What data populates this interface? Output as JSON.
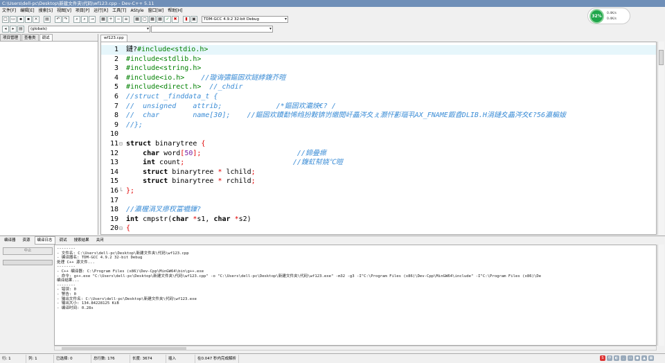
{
  "window": {
    "title": "C:\\Users\\dell-pc\\Desktop\\新建文件夹\\代码\\wf123.cpp - Dev-C++ 5.11"
  },
  "menu": [
    "文件[F]",
    "编辑[E]",
    "搜索[S]",
    "视图[V]",
    "项目[P]",
    "运行[R]",
    "工具[T]",
    "AStyle",
    "窗口[W]",
    "帮助[H]"
  ],
  "toolbar": {
    "compiler": "TDM-GCC 4.9.2 32-bit Debug",
    "scope": "(globals)"
  },
  "widget": {
    "percent": "32%",
    "up": "0.4K/s",
    "down": "0.4K/s"
  },
  "left_tabs": [
    "项目管理",
    "查看类",
    "调试"
  ],
  "editor": {
    "tab": "wf123.cpp",
    "lines": [
      {
        "n": "1",
        "t": "#include<stdio.h>",
        "k": "pp",
        "cur": true,
        "g": "鏈?"
      },
      {
        "n": "2",
        "t": "#include<stdlib.h>",
        "k": "pp"
      },
      {
        "n": "3",
        "t": "#include<string.h>",
        "k": "pp"
      },
      {
        "n": "4",
        "t": "#include<io.h>",
        "k": "pp",
        "c": "    //璇诲彇鏂囦欢鐩綍鍑芥暟"
      },
      {
        "n": "5",
        "t": "#include<direct.h>",
        "k": "pp",
        "c": "  //_chdir"
      },
      {
        "n": "6",
        "t": "//struct _finddata_t {",
        "k": "cm"
      },
      {
        "n": "7",
        "t": "//  unsigned    attrib;             /*鏂囦欢灞炴€? /",
        "k": "cm"
      },
      {
        "n": "8",
        "t": "//  char        name[30];    //鏂囦欢鐨勫悕绉扮敤锛岃繖閲屽畾涔夊ぇ灏忓彲瑙丮AX_FNAME鍜孴DLIB.H涓鏈夊畾涔夊€?56瀛楄妭",
        "k": "cm"
      },
      {
        "n": "9",
        "t": "//};",
        "k": "cm"
      },
      {
        "n": "10",
        "t": ""
      },
      {
        "n": "11",
        "t": "struct binarytree {",
        "k": "code",
        "f": "⊟"
      },
      {
        "n": "12",
        "t": "    char word[50];",
        "k": "code",
        "c": "                       //鍗曡瘝"
      },
      {
        "n": "13",
        "t": "    int count;",
        "k": "code",
        "c": "                          //鍑虹幇娆℃暟"
      },
      {
        "n": "14",
        "t": "    struct binarytree * lchild;",
        "k": "code"
      },
      {
        "n": "15",
        "t": "    struct binarytree * rchild;",
        "k": "code"
      },
      {
        "n": "16",
        "t": "};",
        "k": "code",
        "f": "└"
      },
      {
        "n": "17",
        "t": ""
      },
      {
        "n": "18",
        "t": "//瀛楃涓叉瘮杈冨嚱鏁?",
        "k": "cm"
      },
      {
        "n": "19",
        "t": "int cmpstr(char *s1, char *s2)",
        "k": "code"
      },
      {
        "n": "20",
        "t": "{",
        "k": "code",
        "f": "⊟"
      }
    ]
  },
  "bottom_tabs": [
    "编译器",
    "资源",
    "编译日志",
    "调试",
    "搜索结果",
    "关闭"
  ],
  "stop_label": "中止",
  "log": [
    "--------",
    "- 文件名: C:\\Users\\dell-pc\\Desktop\\新建文件夹\\代码\\wf123.cpp",
    "- 编译器名: TDM-GCC 4.9.2 32-bit Debug",
    "",
    "处理 C++ 源文件...",
    "--------",
    "- C++ 编译器: C:\\Program Files (x86)\\Dev-Cpp\\MinGW64\\bin\\g++.exe",
    "- 命令: g++.exe \"C:\\Users\\dell-pc\\Desktop\\新建文件夹\\代码\\wf123.cpp\" -o \"C:\\Users\\dell-pc\\Desktop\\新建文件夹\\代码\\wf123.exe\" -m32 -g3 -I\"C:\\Program Files (x86)\\Dev-Cpp\\MinGW64\\include\" -I\"C:\\Program Files (x86)\\De",
    "",
    "编译结果...",
    "--------",
    "- 错误: 0",
    "- 警告: 0",
    "- 输出文件名: C:\\Users\\dell-pc\\Desktop\\新建文件夹\\代码\\wf123.exe",
    "- 输出大小: 134.84228125 KiB",
    "- 编译时间: 0.28s"
  ],
  "status": {
    "row_label": "行:",
    "row": "1",
    "col_label": "列:",
    "col": "1",
    "sel_label": "已选择:",
    "sel": "0",
    "total_label": "总行数:",
    "total": "176",
    "len_label": "长度:",
    "len": "3674",
    "mode": "插入",
    "parse": "在0.047 秒内完成解析"
  }
}
